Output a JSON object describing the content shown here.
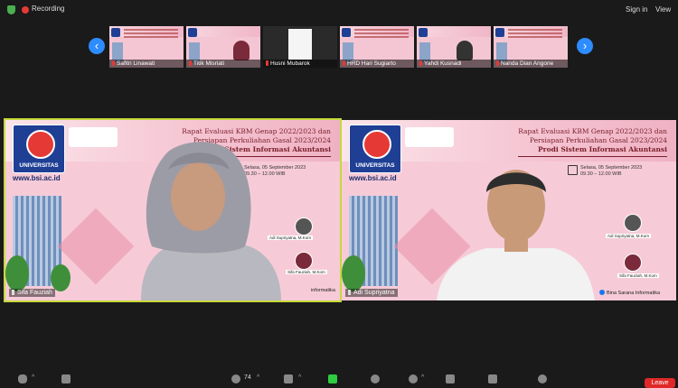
{
  "top_bar": {
    "recording_label": "Recording",
    "signin_label": "Sign in",
    "view_label": "View"
  },
  "gallery_strip": {
    "participants": [
      {
        "name": "Safitri Linawati"
      },
      {
        "name": "Titik Misriati"
      },
      {
        "name": "Husni Mubarok"
      },
      {
        "name": "HRD Hari Sugiarto"
      },
      {
        "name": "Yahdi Kusnadi"
      },
      {
        "name": "Nanda Dian Angone"
      }
    ]
  },
  "main_slide": {
    "logo_text": "UNIVERSITAS",
    "url": "www.bsi.ac.id",
    "title_line1": "Rapat Evaluasi KBM Genap 2022/2023 dan",
    "title_line2": "Persiapan Perkuliahan Gasal 2023/2024",
    "title_line3": "Prodi Sistem Informasi Akuntansi",
    "schedule_date": "Selasa, 05 September 2023",
    "schedule_time": "09.30 – 12.00 WIB",
    "speaker1": "Adi Supriyatna, M.Kom",
    "speaker2": "Sifa Fauziah, M.Kom",
    "footer_left": "Bina Sarana Informatika",
    "footer_right": "informatika"
  },
  "videos": [
    {
      "name": "Sifa Fauziah"
    },
    {
      "name": "Adi Supriyatna"
    }
  ],
  "toolbar": {
    "participant_count": "74",
    "leave_label": "Leave"
  },
  "colors": {
    "background": "#1a1a1a",
    "zoom_blue": "#2d8cff",
    "active_speaker_border": "#c7d93a",
    "leave_red": "#e02828",
    "recording_red": "#e53935"
  }
}
